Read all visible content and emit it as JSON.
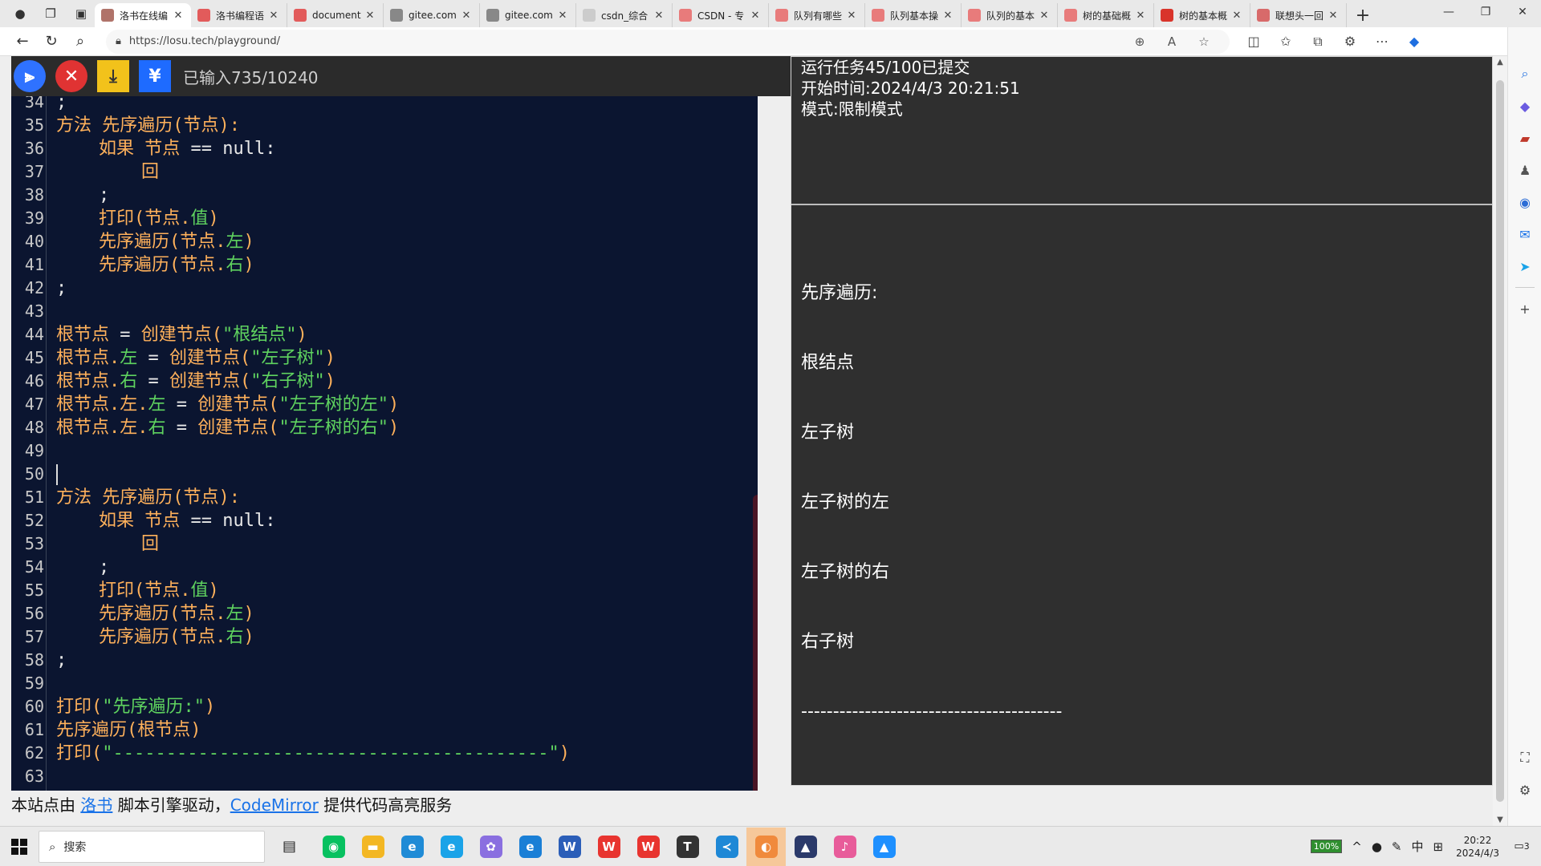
{
  "browser": {
    "tabs": [
      {
        "title": "洛书在线编",
        "favicon_color": "#b0736a",
        "active": true
      },
      {
        "title": "洛书编程语",
        "favicon_color": "#e25b5b"
      },
      {
        "title": "document",
        "favicon_color": "#e25b5b"
      },
      {
        "title": "gitee.com",
        "favicon_color": "#888888"
      },
      {
        "title": "gitee.com",
        "favicon_color": "#888888"
      },
      {
        "title": "csdn_综合",
        "favicon_color": "#cccccc"
      },
      {
        "title": "CSDN - 专",
        "favicon_color": "#e87b7b"
      },
      {
        "title": "队列有哪些",
        "favicon_color": "#e87b7b"
      },
      {
        "title": "队列基本操",
        "favicon_color": "#e87b7b"
      },
      {
        "title": "队列的基本",
        "favicon_color": "#e87b7b"
      },
      {
        "title": "树的基础概",
        "favicon_color": "#e87b7b"
      },
      {
        "title": "树的基本概",
        "favicon_color": "#d9342b"
      },
      {
        "title": "联想头一回",
        "favicon_color": "#d86a6a"
      }
    ],
    "url": "https://losu.tech/playground/"
  },
  "toolbar": {
    "char_count": "已输入735/10240",
    "run_color": "#2f72ff",
    "stop_color": "#e03333",
    "download_color": "#f2c21b",
    "alt_color": "#1e6bff"
  },
  "editor": {
    "lines": [
      {
        "n": "34",
        "code": [
          {
            "t": ";",
            "c": "w"
          }
        ]
      },
      {
        "n": "35",
        "code": [
          {
            "t": "方法 先序遍历(节点):",
            "c": "k"
          }
        ]
      },
      {
        "n": "36",
        "code": [
          {
            "t": "    如果 节点 ",
            "c": "k"
          },
          {
            "t": "== null:",
            "c": "w"
          }
        ]
      },
      {
        "n": "37",
        "code": [
          {
            "t": "        回",
            "c": "k"
          }
        ]
      },
      {
        "n": "38",
        "code": [
          {
            "t": "    ;",
            "c": "w"
          }
        ]
      },
      {
        "n": "39",
        "code": [
          {
            "t": "    打印(节点.",
            "c": "k"
          },
          {
            "t": "值",
            "c": "g"
          },
          {
            "t": ")",
            "c": "k"
          }
        ]
      },
      {
        "n": "40",
        "code": [
          {
            "t": "    先序遍历(节点.",
            "c": "k"
          },
          {
            "t": "左",
            "c": "g"
          },
          {
            "t": ")",
            "c": "k"
          }
        ]
      },
      {
        "n": "41",
        "code": [
          {
            "t": "    先序遍历(节点.",
            "c": "k"
          },
          {
            "t": "右",
            "c": "g"
          },
          {
            "t": ")",
            "c": "k"
          }
        ]
      },
      {
        "n": "42",
        "code": [
          {
            "t": ";",
            "c": "w"
          }
        ]
      },
      {
        "n": "43",
        "code": []
      },
      {
        "n": "44",
        "code": [
          {
            "t": "根节点 ",
            "c": "k"
          },
          {
            "t": "= ",
            "c": "w"
          },
          {
            "t": "创建节点(",
            "c": "k"
          },
          {
            "t": "\"根结点\"",
            "c": "s"
          },
          {
            "t": ")",
            "c": "k"
          }
        ]
      },
      {
        "n": "45",
        "code": [
          {
            "t": "根节点.",
            "c": "k"
          },
          {
            "t": "左",
            "c": "g"
          },
          {
            "t": " = ",
            "c": "w"
          },
          {
            "t": "创建节点(",
            "c": "k"
          },
          {
            "t": "\"左子树\"",
            "c": "s"
          },
          {
            "t": ")",
            "c": "k"
          }
        ]
      },
      {
        "n": "46",
        "code": [
          {
            "t": "根节点.",
            "c": "k"
          },
          {
            "t": "右",
            "c": "g"
          },
          {
            "t": " = ",
            "c": "w"
          },
          {
            "t": "创建节点(",
            "c": "k"
          },
          {
            "t": "\"右子树\"",
            "c": "s"
          },
          {
            "t": ")",
            "c": "k"
          }
        ]
      },
      {
        "n": "47",
        "code": [
          {
            "t": "根节点.左.",
            "c": "k"
          },
          {
            "t": "左",
            "c": "g"
          },
          {
            "t": " = ",
            "c": "w"
          },
          {
            "t": "创建节点(",
            "c": "k"
          },
          {
            "t": "\"左子树的左\"",
            "c": "s"
          },
          {
            "t": ")",
            "c": "k"
          }
        ]
      },
      {
        "n": "48",
        "code": [
          {
            "t": "根节点.左.",
            "c": "k"
          },
          {
            "t": "右",
            "c": "g"
          },
          {
            "t": " = ",
            "c": "w"
          },
          {
            "t": "创建节点(",
            "c": "k"
          },
          {
            "t": "\"左子树的右\"",
            "c": "s"
          },
          {
            "t": ")",
            "c": "k"
          }
        ]
      },
      {
        "n": "49",
        "code": []
      },
      {
        "n": "50",
        "code": []
      },
      {
        "n": "51",
        "code": [
          {
            "t": "方法 先序遍历(节点):",
            "c": "k"
          }
        ]
      },
      {
        "n": "52",
        "code": [
          {
            "t": "    如果 节点 ",
            "c": "k"
          },
          {
            "t": "== null:",
            "c": "w"
          }
        ]
      },
      {
        "n": "53",
        "code": [
          {
            "t": "        回",
            "c": "k"
          }
        ]
      },
      {
        "n": "54",
        "code": [
          {
            "t": "    ;",
            "c": "w"
          }
        ]
      },
      {
        "n": "55",
        "code": [
          {
            "t": "    打印(节点.",
            "c": "k"
          },
          {
            "t": "值",
            "c": "g"
          },
          {
            "t": ")",
            "c": "k"
          }
        ]
      },
      {
        "n": "56",
        "code": [
          {
            "t": "    先序遍历(节点.",
            "c": "k"
          },
          {
            "t": "左",
            "c": "g"
          },
          {
            "t": ")",
            "c": "k"
          }
        ]
      },
      {
        "n": "57",
        "code": [
          {
            "t": "    先序遍历(节点.",
            "c": "k"
          },
          {
            "t": "右",
            "c": "g"
          },
          {
            "t": ")",
            "c": "k"
          }
        ]
      },
      {
        "n": "58",
        "code": [
          {
            "t": ";",
            "c": "w"
          }
        ]
      },
      {
        "n": "59",
        "code": []
      },
      {
        "n": "60",
        "code": [
          {
            "t": "打印(",
            "c": "k"
          },
          {
            "t": "\"先序遍历:\"",
            "c": "s"
          },
          {
            "t": ")",
            "c": "k"
          }
        ]
      },
      {
        "n": "61",
        "code": [
          {
            "t": "先序遍历(根节点)",
            "c": "k"
          }
        ]
      },
      {
        "n": "62",
        "code": [
          {
            "t": "打印(",
            "c": "k"
          },
          {
            "t": "\"-----------------------------------------\"",
            "c": "s"
          },
          {
            "t": ")",
            "c": "k"
          }
        ]
      },
      {
        "n": "63",
        "code": []
      }
    ]
  },
  "output": {
    "info": [
      "运行任务45/100已提交",
      "开始时间:2024/4/3 20:21:51",
      "模式:限制模式"
    ],
    "lines": [
      "先序遍历:",
      "根结点",
      "左子树",
      "左子树的左",
      "左子树的右",
      "右子树",
      "-----------------------------------------"
    ]
  },
  "footer": {
    "prefix": "本站点由 ",
    "link1": "洛书",
    "middle": " 脚本引擎驱动，",
    "link2": "CodeMirror",
    "suffix": " 提供代码高亮服务"
  },
  "taskbar": {
    "search_placeholder": "搜索",
    "apps": [
      {
        "name": "wechat",
        "color": "#07c160",
        "glyph": "◉"
      },
      {
        "name": "file-explorer",
        "color": "#f3b723",
        "glyph": "▬"
      },
      {
        "name": "edge-dev",
        "color": "#1f8bd6",
        "glyph": "e"
      },
      {
        "name": "edge-beta",
        "color": "#1aa3e8",
        "glyph": "e"
      },
      {
        "name": "app-cluster",
        "color": "#8a6fe0",
        "glyph": "✿"
      },
      {
        "name": "edge",
        "color": "#1a7fd6",
        "glyph": "e"
      },
      {
        "name": "word",
        "color": "#2b5eb8",
        "glyph": "W"
      },
      {
        "name": "wps",
        "color": "#e8342f",
        "glyph": "W"
      },
      {
        "name": "wps-alt",
        "color": "#e8342f",
        "glyph": "W"
      },
      {
        "name": "typora",
        "color": "#333333",
        "glyph": "T"
      },
      {
        "name": "vscode",
        "color": "#1e88d6",
        "glyph": "≺"
      },
      {
        "name": "active-app",
        "color": "#f08a3c",
        "glyph": "◐",
        "active": true
      },
      {
        "name": "cat-app",
        "color": "#2b3a6a",
        "glyph": "▲"
      },
      {
        "name": "audio-app",
        "color": "#e85c9a",
        "glyph": "♪"
      },
      {
        "name": "photo-app",
        "color": "#1e90ff",
        "glyph": "▲"
      }
    ],
    "battery": "100%",
    "ime": "中",
    "time": "20:22",
    "date": "2024/4/3",
    "notif_count": "3"
  }
}
